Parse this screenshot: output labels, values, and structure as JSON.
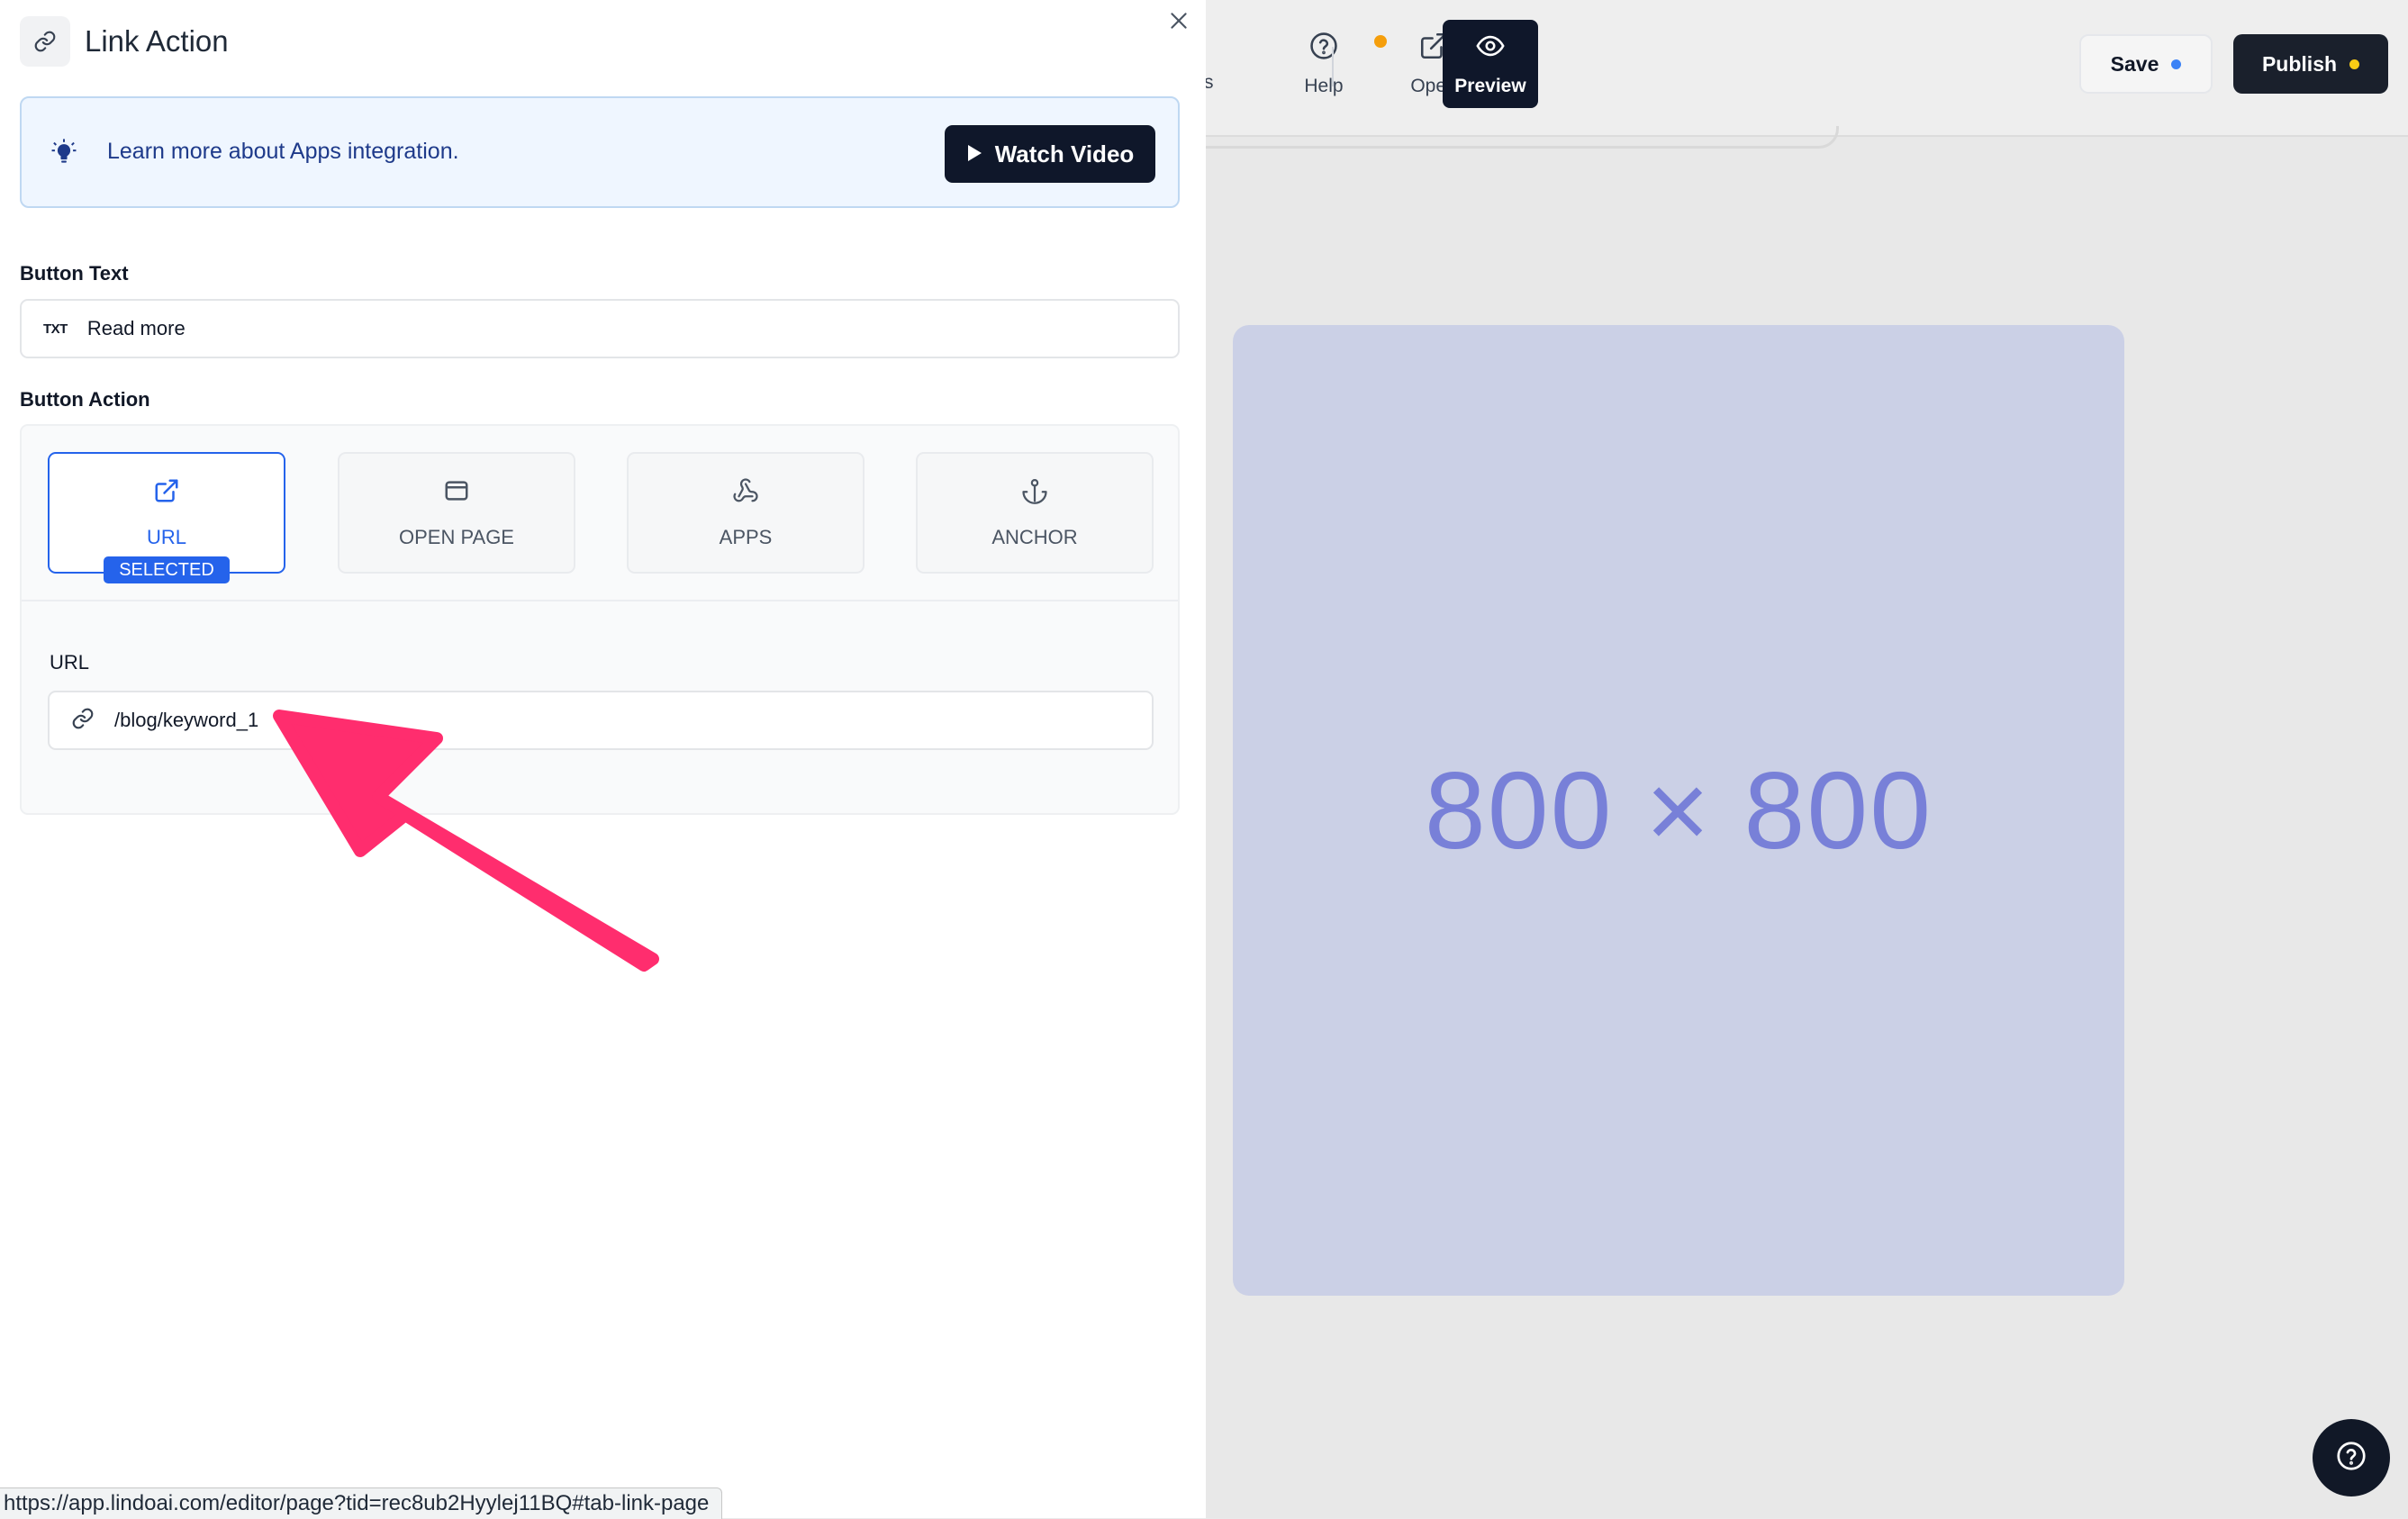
{
  "panel": {
    "title": "Link Action",
    "info_banner": {
      "text": "Learn more about Apps integration.",
      "button_label": "Watch Video"
    },
    "button_text_field": {
      "label": "Button Text",
      "icon_text": "TXT",
      "value": "Read more"
    },
    "button_action": {
      "label": "Button Action",
      "options": [
        {
          "label": "URL",
          "icon": "external-link-icon",
          "selected": true
        },
        {
          "label": "OPEN PAGE",
          "icon": "window-icon",
          "selected": false
        },
        {
          "label": "APPS",
          "icon": "webhook-icon",
          "selected": false
        },
        {
          "label": "ANCHOR",
          "icon": "anchor-icon",
          "selected": false
        }
      ],
      "selected_badge": "SELECTED",
      "url_field": {
        "label": "URL",
        "value": "/blog/keyword_1"
      }
    }
  },
  "toolbar": {
    "partial_label": "s",
    "help_label": "Help",
    "open_label": "Open",
    "preview_label": "Preview",
    "save_label": "Save",
    "publish_label": "Publish"
  },
  "canvas": {
    "placeholder_label": "800 × 800"
  },
  "status_bar": {
    "url": "https://app.lindoai.com/editor/page?tid=rec8ub2Hyylej11BQ#tab-link-page"
  },
  "colors": {
    "accent": "#2563eb",
    "dark": "#0f172a",
    "arrow": "#ff2d6e",
    "help_dot": "#f59e0b",
    "save_dot": "#3b82f6",
    "publish_dot": "#facc15"
  }
}
